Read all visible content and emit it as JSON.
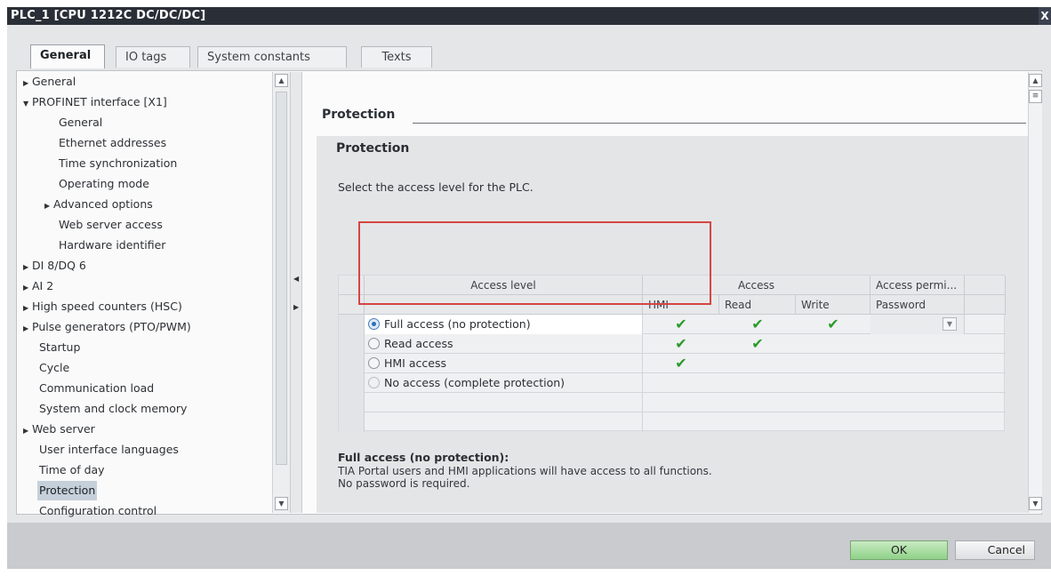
{
  "window": {
    "title": "PLC_1 [CPU 1212C DC/DC/DC]",
    "close_glyph": "X"
  },
  "tabs": [
    {
      "label": "General"
    },
    {
      "label": "IO tags"
    },
    {
      "label": "System constants"
    },
    {
      "label": "Texts"
    }
  ],
  "nav": {
    "items": [
      {
        "label": "General",
        "expander": "collapsed"
      },
      {
        "label": "PROFINET interface [X1]",
        "expander": "expanded"
      },
      {
        "label": "General"
      },
      {
        "label": "Ethernet addresses"
      },
      {
        "label": "Time synchronization"
      },
      {
        "label": "Operating mode"
      },
      {
        "label": "Advanced options",
        "expander": "collapsed"
      },
      {
        "label": "Web server access"
      },
      {
        "label": "Hardware identifier"
      },
      {
        "label": "DI 8/DQ 6",
        "expander": "collapsed"
      },
      {
        "label": "AI 2",
        "expander": "collapsed"
      },
      {
        "label": "High speed counters (HSC)",
        "expander": "collapsed"
      },
      {
        "label": "Pulse generators (PTO/PWM)",
        "expander": "collapsed"
      },
      {
        "label": "Startup"
      },
      {
        "label": "Cycle"
      },
      {
        "label": "Communication load"
      },
      {
        "label": "System and clock memory"
      },
      {
        "label": "Web server",
        "expander": "collapsed"
      },
      {
        "label": "User interface languages"
      },
      {
        "label": "Time of day"
      },
      {
        "label": "Protection",
        "selected": true
      },
      {
        "label": "Configuration control"
      }
    ]
  },
  "main": {
    "header": "Protection",
    "section_title": "Protection",
    "instruction": "Select the access level for the PLC.",
    "table": {
      "group_headers": {
        "access_level": "Access level",
        "access": "Access",
        "access_permission": "Access permi..."
      },
      "sub_headers": {
        "hmi": "HMI",
        "read": "Read",
        "write": "Write",
        "password": "Password"
      },
      "rows": [
        {
          "label": "Full access (no protection)",
          "selected": true,
          "hmi": true,
          "read": true,
          "write": true
        },
        {
          "label": "Read access",
          "selected": false,
          "hmi": true,
          "read": true,
          "write": false
        },
        {
          "label": "HMI access",
          "selected": false,
          "hmi": true,
          "read": false,
          "write": false
        },
        {
          "label": "No access (complete protection)",
          "selected": false,
          "hmi": false,
          "read": false,
          "write": false
        }
      ],
      "check_glyph": "✔"
    },
    "description": {
      "title": "Full access (no protection):",
      "line1": "TIA Portal users and HMI applications will have access to all functions.",
      "line2": "No password is required."
    }
  },
  "footer": {
    "ok": "OK",
    "cancel": "Cancel"
  },
  "colors": {
    "highlight_box": "#d64545",
    "check": "#2a9a2a",
    "ok_button": "#8fd188",
    "title_bar": "#2a2f37"
  }
}
